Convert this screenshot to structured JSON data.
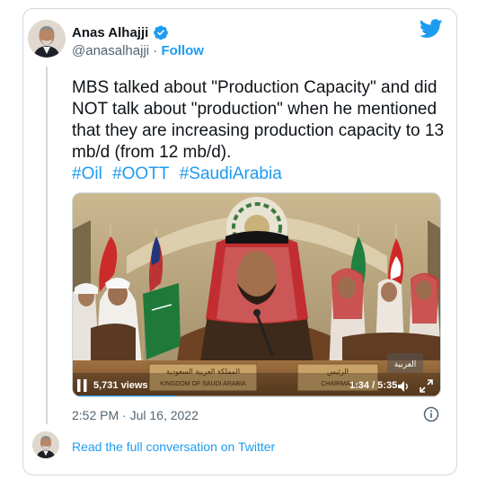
{
  "author": {
    "display_name": "Anas Alhajji",
    "handle": "@anasalhajji",
    "separator": "·",
    "follow_label": "Follow",
    "verified": true
  },
  "tweet": {
    "text": "MBS talked about \"Production Capacity\" and did NOT talk about \"production\" when he mentioned that they are increasing production capacity to 13 mb/d (from 12 mb/d).",
    "hashtags": [
      "#Oil",
      "#OOTT",
      "#SaudiArabia"
    ]
  },
  "video": {
    "views": "5,731 views",
    "time": "1:34 / 5:35",
    "progress_fraction": 0.28,
    "nameplate_left_arabic": "المملكة العربية السعودية",
    "nameplate_left_english": "KINGDOM OF SAUDI ARABIA",
    "nameplate_right_arabic": "الرئيس",
    "nameplate_right_english": "CHAIRMAN",
    "watermark": "العربية"
  },
  "footer": {
    "timestamp": "2:52 PM · Jul 16, 2022",
    "read_conversation": "Read the full conversation on Twitter"
  },
  "icons": {
    "verified": "verified-badge-icon",
    "twitter": "twitter-bird-icon",
    "play": "play-icon",
    "volume": "volume-icon",
    "fullscreen": "fullscreen-icon",
    "info": "info-icon"
  },
  "colors": {
    "accent": "#1d9bf0",
    "text": "#0f1419",
    "muted": "#536471",
    "border": "#cfd9de"
  }
}
